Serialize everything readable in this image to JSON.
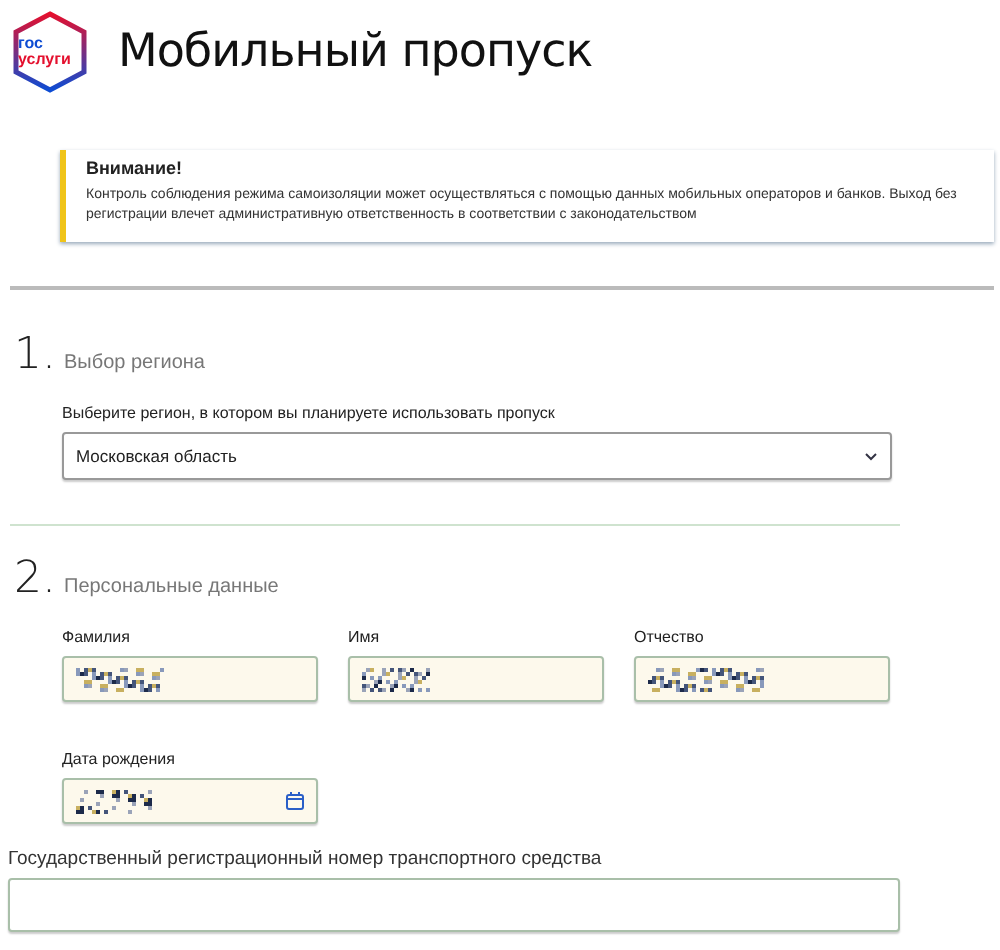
{
  "header": {
    "logo_lines": [
      "гос",
      "услуги"
    ],
    "title": "Мобильный пропуск"
  },
  "alert": {
    "title": "Внимание!",
    "text": "Контроль соблюдения режима самоизоляции может осуществляться с помощью данных мобильных операторов и банков. Выход без регистрации влечет административную ответственность в соответствии с законодательством"
  },
  "sections": [
    {
      "number": "1.",
      "title": "Выбор региона",
      "fields": [
        {
          "kind": "select",
          "label": "Выберите регион, в котором вы планируете использовать пропуск",
          "value": "Московская область"
        }
      ]
    },
    {
      "number": "2.",
      "title": "Персональные данные",
      "fields": [
        {
          "kind": "text",
          "label": "Фамилия",
          "redacted": true
        },
        {
          "kind": "text",
          "label": "Имя",
          "redacted": true
        },
        {
          "kind": "text",
          "label": "Отчество",
          "redacted": true
        },
        {
          "kind": "date",
          "label": "Дата рождения",
          "redacted": true
        },
        {
          "kind": "wide",
          "label": "Государственный регистрационный номер транспортного средства"
        }
      ]
    }
  ]
}
